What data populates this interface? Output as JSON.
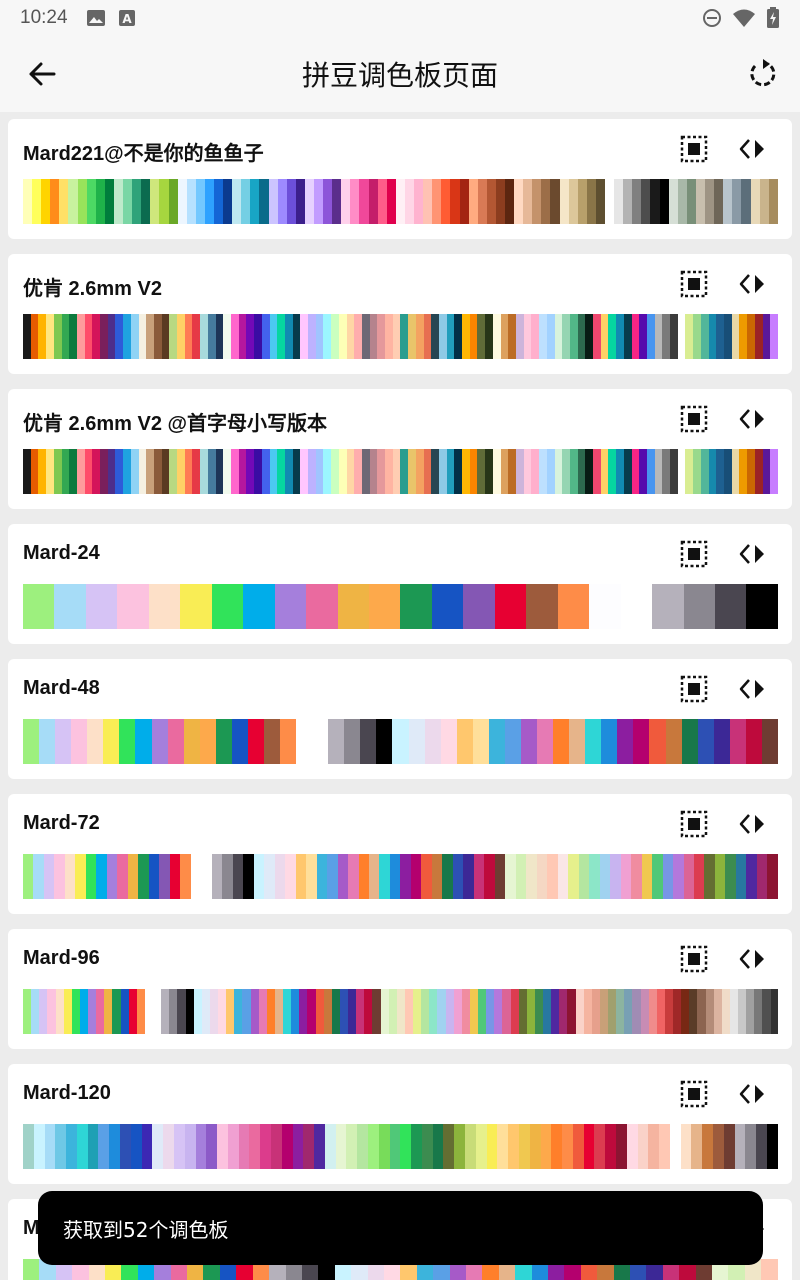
{
  "status_bar": {
    "time": "10:24",
    "icons": [
      "image-icon",
      "a-box-icon",
      "dnd-icon",
      "wifi-icon",
      "battery-icon"
    ]
  },
  "app_bar": {
    "title": "拼豆调色板页面",
    "back_icon": "arrow-left-icon",
    "refresh_icon": "refresh-icon"
  },
  "palettes": [
    {
      "name": "Mard221@不是你的鱼鱼子",
      "colors": [
        "#ffffb8",
        "#ffff5c",
        "#ffd400",
        "#ff8c1a",
        "#ffe066",
        "#c8f29e",
        "#98e35b",
        "#4cd964",
        "#1fb24a",
        "#007d3c",
        "#bfeacb",
        "#7ad6a5",
        "#2fa37a",
        "#0b6b4f",
        "#cfe77c",
        "#a6d63f",
        "#6aa827",
        "#edf6ff",
        "#b6e1ff",
        "#73c8ff",
        "#2ea2ff",
        "#1466d6",
        "#0b3a8f",
        "#bfe8f1",
        "#74cfe4",
        "#18a5c5",
        "#0a6b8a",
        "#ccc4ff",
        "#9d8aff",
        "#6c4fd9",
        "#3c1f8c",
        "#e6d1ff",
        "#c29cff",
        "#8d55d9",
        "#5b2e8c",
        "#ffd1eb",
        "#ff8cc6",
        "#f0489a",
        "#c41d6a",
        "#ff5c8a",
        "#e0004d",
        "#fff0f5",
        "#ffd6e6",
        "#ffb3cf",
        "#ffc2b3",
        "#ff9473",
        "#ff5c33",
        "#d93616",
        "#a32412",
        "#ffab80",
        "#d97a55",
        "#b35733",
        "#8c3d1f",
        "#5c2610",
        "#ffd9c2",
        "#e6b898",
        "#c4926b",
        "#9c6e48",
        "#6b4a2e",
        "#f5e6c8",
        "#dcc79a",
        "#b8a06b",
        "#8a7548",
        "#5e4f30",
        "#ffffff",
        "#e6e6e6",
        "#b3b3b3",
        "#808080",
        "#4d4d4d",
        "#1a1a1a",
        "#000000",
        "#d6dfd6",
        "#a8b8a8",
        "#788f78",
        "#c8bfae",
        "#9e9484",
        "#6e6658",
        "#b8c4cc",
        "#8a9aa6",
        "#5c6e7a",
        "#e8d9b8",
        "#c9b48c",
        "#a68c5e"
      ]
    },
    {
      "name": "优肯 2.6mm V2",
      "colors": [
        "#1a1a1a",
        "#e65c00",
        "#ffb300",
        "#ffe680",
        "#7ec850",
        "#33a852",
        "#0d7a3e",
        "#ff9c9c",
        "#ff4d6a",
        "#d4145a",
        "#7a1f5c",
        "#4d2e8c",
        "#2e5bd9",
        "#1fa3e0",
        "#8fd3f5",
        "#f5f0e1",
        "#c8a07a",
        "#8a5a3a",
        "#5a3a22",
        "#b8d982",
        "#ffd166",
        "#ff7b54",
        "#e63946",
        "#a8dadc",
        "#457b9d",
        "#1d3557",
        "#f1faee",
        "#ff66cc",
        "#b5179e",
        "#7209b7",
        "#3a0ca3",
        "#4361ee",
        "#4cc9f0",
        "#06d6a0",
        "#118ab2",
        "#073b4c",
        "#ffc6ff",
        "#bdb2ff",
        "#a0c4ff",
        "#9bf6ff",
        "#caffbf",
        "#fdffb6",
        "#ffd6a5",
        "#ffadad",
        "#6d6875",
        "#b5838d",
        "#e5989b",
        "#ffb4a2",
        "#ffcdb2",
        "#2a9d8f",
        "#e9c46a",
        "#f4a261",
        "#e76f51",
        "#264653",
        "#8ecae6",
        "#219ebc",
        "#023047",
        "#ffb703",
        "#fb8500",
        "#606c38",
        "#283618",
        "#fefae0",
        "#dda15e",
        "#bc6c25",
        "#cdb4db",
        "#ffc8dd",
        "#ffafcc",
        "#bde0fe",
        "#a2d2ff",
        "#d8f3dc",
        "#95d5b2",
        "#52b788",
        "#2d6a4f",
        "#081c15",
        "#ef476f",
        "#ffd166",
        "#06d6a0",
        "#118ab2",
        "#073b4c",
        "#f72585",
        "#560bad",
        "#4895ef",
        "#b8b8b8",
        "#7a7a7a",
        "#3c3c3c",
        "#ffffff",
        "#d9ed92",
        "#99d98c",
        "#52b69a",
        "#168aad",
        "#1e6091",
        "#184e77",
        "#e9d8a6",
        "#ee9b00",
        "#ca6702",
        "#9b2226",
        "#5a189a",
        "#c77dff"
      ]
    },
    {
      "name": "优肯 2.6mm V2 @首字母小写版本",
      "colors": [
        "#1a1a1a",
        "#e65c00",
        "#ffb300",
        "#ffe680",
        "#7ec850",
        "#33a852",
        "#0d7a3e",
        "#ff9c9c",
        "#ff4d6a",
        "#d4145a",
        "#7a1f5c",
        "#4d2e8c",
        "#2e5bd9",
        "#1fa3e0",
        "#8fd3f5",
        "#f5f0e1",
        "#c8a07a",
        "#8a5a3a",
        "#5a3a22",
        "#b8d982",
        "#ffd166",
        "#ff7b54",
        "#e63946",
        "#a8dadc",
        "#457b9d",
        "#1d3557",
        "#f1faee",
        "#ff66cc",
        "#b5179e",
        "#7209b7",
        "#3a0ca3",
        "#4361ee",
        "#4cc9f0",
        "#06d6a0",
        "#118ab2",
        "#073b4c",
        "#ffc6ff",
        "#bdb2ff",
        "#a0c4ff",
        "#9bf6ff",
        "#caffbf",
        "#fdffb6",
        "#ffd6a5",
        "#ffadad",
        "#6d6875",
        "#b5838d",
        "#e5989b",
        "#ffb4a2",
        "#ffcdb2",
        "#2a9d8f",
        "#e9c46a",
        "#f4a261",
        "#e76f51",
        "#264653",
        "#8ecae6",
        "#219ebc",
        "#023047",
        "#ffb703",
        "#fb8500",
        "#606c38",
        "#283618",
        "#fefae0",
        "#dda15e",
        "#bc6c25",
        "#cdb4db",
        "#ffc8dd",
        "#ffafcc",
        "#bde0fe",
        "#a2d2ff",
        "#d8f3dc",
        "#95d5b2",
        "#52b788",
        "#2d6a4f",
        "#081c15",
        "#ef476f",
        "#ffd166",
        "#06d6a0",
        "#118ab2",
        "#073b4c",
        "#f72585",
        "#560bad",
        "#4895ef",
        "#b8b8b8",
        "#7a7a7a",
        "#3c3c3c",
        "#ffffff",
        "#d9ed92",
        "#99d98c",
        "#52b69a",
        "#168aad",
        "#1e6091",
        "#184e77",
        "#e9d8a6",
        "#ee9b00",
        "#ca6702",
        "#9b2226",
        "#5a189a",
        "#c77dff"
      ]
    },
    {
      "name": "Mard-24",
      "colors": [
        "#9df07e",
        "#a6dcf7",
        "#d6c3f5",
        "#fcc2df",
        "#fde0c8",
        "#f9ed55",
        "#31e35a",
        "#00adea",
        "#a57fdc",
        "#ea6a9f",
        "#efb444",
        "#fda94b",
        "#1c9853",
        "#1654c3",
        "#8457b4",
        "#e70032",
        "#9d5b3c",
        "#fe8c48",
        "#fdfdff",
        "#ffffff",
        "#b5b1bb",
        "#8a8790",
        "#4a4650",
        "#000000"
      ]
    },
    {
      "name": "Mard-48",
      "colors": [
        "#9df07e",
        "#a6dcf7",
        "#d6c3f5",
        "#fcc2df",
        "#fde0c8",
        "#f9ed55",
        "#31e35a",
        "#00adea",
        "#a57fdc",
        "#ea6a9f",
        "#efb444",
        "#fda94b",
        "#1c9853",
        "#1654c3",
        "#e70032",
        "#9d5b3c",
        "#fe8c48",
        "#ffffff",
        "#ffffff",
        "#b5b1bb",
        "#8a8790",
        "#4a4650",
        "#000000",
        "#c9f3ff",
        "#dfeaf8",
        "#ecd9ec",
        "#ffd9e4",
        "#ffc76d",
        "#ffdf9a",
        "#3cb4dc",
        "#5aa0e6",
        "#a65ac8",
        "#e67ab4",
        "#ff7f2a",
        "#e6b48a",
        "#2ed6d6",
        "#1e8cdc",
        "#8c1ea0",
        "#b4006e",
        "#f05a3c",
        "#c8783c",
        "#18784a",
        "#2d50b4",
        "#3c2896",
        "#c83278",
        "#be0a3c",
        "#6e3c32"
      ]
    },
    {
      "name": "Mard-72",
      "colors": [
        "#9df07e",
        "#a6dcf7",
        "#d6c3f5",
        "#fcc2df",
        "#fde0c8",
        "#f9ed55",
        "#31e35a",
        "#00adea",
        "#a57fdc",
        "#ea6a9f",
        "#efb444",
        "#1c9853",
        "#1654c3",
        "#8457b4",
        "#e70032",
        "#fe8c48",
        "#ffffff",
        "#ffffff",
        "#b5b1bb",
        "#8a8790",
        "#4a4650",
        "#000000",
        "#c9f3ff",
        "#dfeaf8",
        "#ecd9ec",
        "#ffd9e4",
        "#ffc76d",
        "#ffdf9a",
        "#3cb4dc",
        "#5aa0e6",
        "#a65ac8",
        "#e67ab4",
        "#ff7f2a",
        "#e6b48a",
        "#2ed6d6",
        "#1e8cdc",
        "#8c1ea0",
        "#b4006e",
        "#f05a3c",
        "#c8783c",
        "#18784a",
        "#2d50b4",
        "#3c2896",
        "#c83278",
        "#be0a3c",
        "#6e3c32",
        "#e6f5d2",
        "#d2f0b4",
        "#f0e6c8",
        "#f5d7c3",
        "#ffc8b4",
        "#fae6e6",
        "#e6f08c",
        "#b4e6a0",
        "#8ce6c8",
        "#a0d2f0",
        "#c8b4f0",
        "#f0a0d2",
        "#f08ca0",
        "#f0c850",
        "#50c878",
        "#7896e6",
        "#b478dc",
        "#dc6496",
        "#dc3c50",
        "#646e32",
        "#8cb43c",
        "#3c8c50",
        "#2878a0",
        "#5028a0",
        "#a0286e",
        "#8c1432"
      ]
    },
    {
      "name": "Mard-96",
      "colors": [
        "#9df07e",
        "#a6dcf7",
        "#d6c3f5",
        "#fcc2df",
        "#fde0c8",
        "#f9ed55",
        "#31e35a",
        "#00adea",
        "#a57fdc",
        "#ea6a9f",
        "#efb444",
        "#1c9853",
        "#1654c3",
        "#e70032",
        "#fe8c48",
        "#ffffff",
        "#ffffff",
        "#b5b1bb",
        "#8a8790",
        "#4a4650",
        "#000000",
        "#c9f3ff",
        "#dfeaf8",
        "#ecd9ec",
        "#ffd9e4",
        "#ffc76d",
        "#3cb4dc",
        "#5aa0e6",
        "#a65ac8",
        "#e67ab4",
        "#ff7f2a",
        "#e6b48a",
        "#2ed6d6",
        "#1e8cdc",
        "#8c1ea0",
        "#b4006e",
        "#f05a3c",
        "#c8783c",
        "#18784a",
        "#2d50b4",
        "#3c2896",
        "#c83278",
        "#be0a3c",
        "#6e3c32",
        "#e6f5d2",
        "#d2f0b4",
        "#f0e6c8",
        "#ffc8b4",
        "#e6f08c",
        "#b4e6a0",
        "#8ce6c8",
        "#a0d2f0",
        "#c8b4f0",
        "#f0a0d2",
        "#f08ca0",
        "#f0c850",
        "#50c878",
        "#7896e6",
        "#b478dc",
        "#dc6496",
        "#dc3c50",
        "#646e32",
        "#8cb43c",
        "#3c8c50",
        "#2878a0",
        "#5028a0",
        "#a0286e",
        "#8c1432",
        "#fad2c8",
        "#f5b4a0",
        "#e6a08c",
        "#c8a078",
        "#a0a06e",
        "#8cb4a0",
        "#78a0b4",
        "#a08cb4",
        "#c88cb4",
        "#f08c8c",
        "#f06464",
        "#c83c3c",
        "#a02828",
        "#782814",
        "#5a3c28",
        "#8c6450",
        "#b48c78",
        "#dcb4a0",
        "#f0dcc8",
        "#e6e6e6",
        "#c8c8c8",
        "#a0a0a0",
        "#787878",
        "#505050",
        "#323232"
      ]
    },
    {
      "name": "Mard-120",
      "colors": [
        "#a0d2c8",
        "#c9f3ff",
        "#a6dcf7",
        "#6ec8e6",
        "#3cb4dc",
        "#2ed6d6",
        "#1ea0b4",
        "#5aa0e6",
        "#1e8cdc",
        "#2d50b4",
        "#1654c3",
        "#3c28b4",
        "#dfeaf8",
        "#ecd9ec",
        "#d6c3f5",
        "#c8b4f0",
        "#a57fdc",
        "#8c5ac8",
        "#fcc2df",
        "#f0a0d2",
        "#e67ab4",
        "#ea6a9f",
        "#dc3c8c",
        "#c83278",
        "#b4006e",
        "#8c1ea0",
        "#a0286e",
        "#5028a0",
        "#d2f0f0",
        "#e6f5d2",
        "#d2f0b4",
        "#b4e6a0",
        "#9df07e",
        "#78dc5a",
        "#50c878",
        "#31e35a",
        "#1c9853",
        "#3c8c50",
        "#18784a",
        "#646e32",
        "#8cb43c",
        "#c8dc78",
        "#e6f08c",
        "#f9ed55",
        "#ffdf9a",
        "#ffc76d",
        "#f0c850",
        "#efb444",
        "#fda94b",
        "#ff7f2a",
        "#fe8c48",
        "#f05a3c",
        "#e70032",
        "#dc3c50",
        "#be0a3c",
        "#8c1432",
        "#ffd9e4",
        "#fad2c8",
        "#f5b4a0",
        "#ffc8b4",
        "#ffffff",
        "#fde0c8",
        "#e6b48a",
        "#c8783c",
        "#9d5b3c",
        "#6e3c32",
        "#b5b1bb",
        "#8a8790",
        "#4a4650",
        "#000000"
      ]
    },
    {
      "name": "Mard-144",
      "colors": [
        "#9df07e",
        "#a6dcf7",
        "#d6c3f5",
        "#fcc2df",
        "#fde0c8",
        "#f9ed55",
        "#31e35a",
        "#00adea",
        "#a57fdc",
        "#ea6a9f",
        "#efb444",
        "#1c9853",
        "#1654c3",
        "#e70032",
        "#fe8c48",
        "#b5b1bb",
        "#8a8790",
        "#4a4650",
        "#000000",
        "#c9f3ff",
        "#dfeaf8",
        "#ecd9ec",
        "#ffd9e4",
        "#ffc76d",
        "#3cb4dc",
        "#5aa0e6",
        "#a65ac8",
        "#e67ab4",
        "#ff7f2a",
        "#e6b48a",
        "#2ed6d6",
        "#1e8cdc",
        "#8c1ea0",
        "#b4006e",
        "#f05a3c",
        "#c8783c",
        "#18784a",
        "#2d50b4",
        "#3c2896",
        "#c83278",
        "#be0a3c",
        "#6e3c32",
        "#e6f5d2",
        "#d2f0b4",
        "#f0e6c8",
        "#ffc8b4"
      ]
    }
  ],
  "toast": {
    "message": "获取到52个调色板"
  }
}
